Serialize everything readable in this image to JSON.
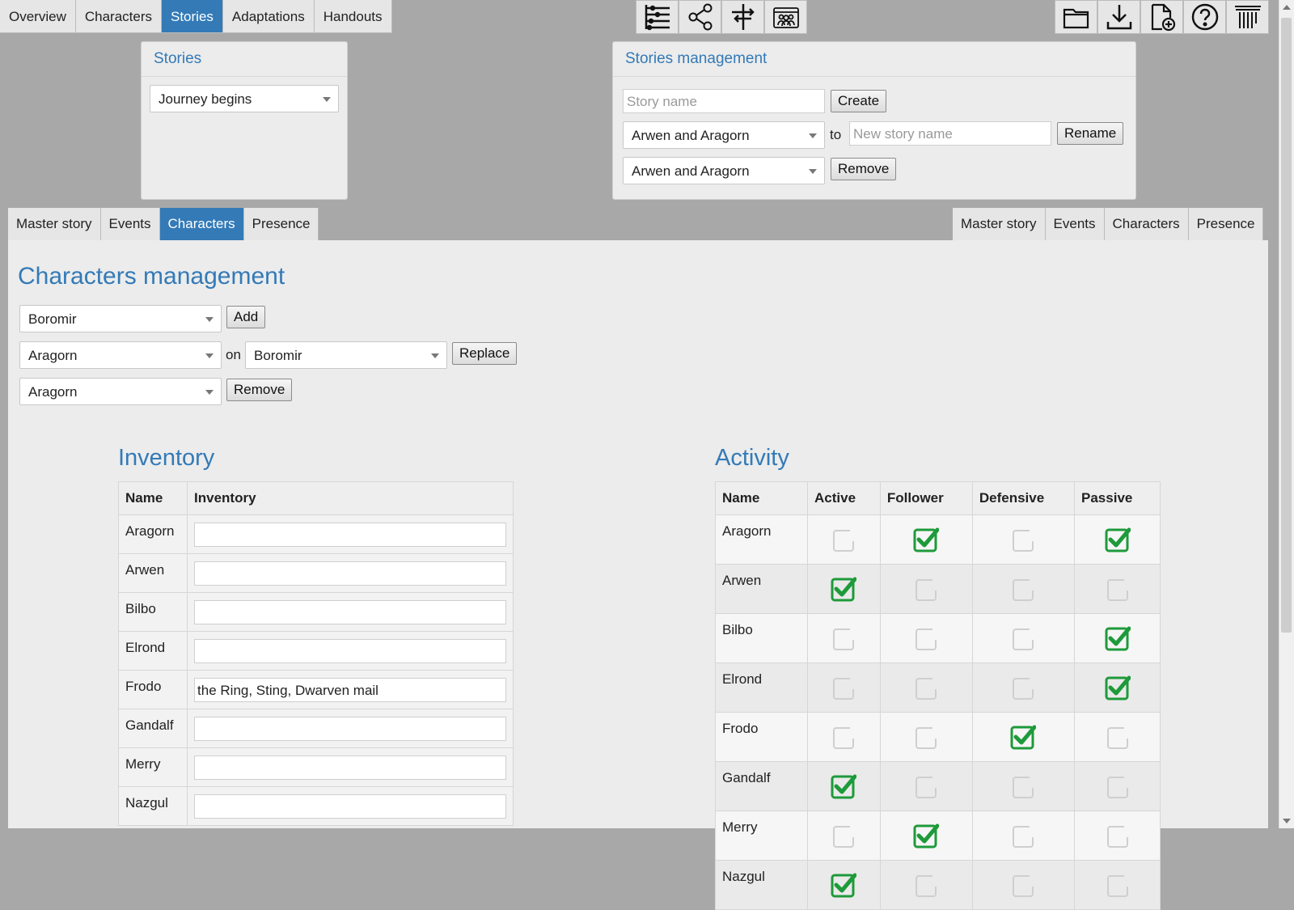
{
  "topnav": {
    "tabs": [
      "Overview",
      "Characters",
      "Stories",
      "Adaptations",
      "Handouts"
    ],
    "active": "Stories"
  },
  "toolbar": {
    "center_icons": [
      "timeline-icon",
      "share-icon",
      "signpost-icon",
      "group-icon"
    ],
    "right_icons": [
      "folder-icon",
      "download-icon",
      "new-file-icon",
      "help-icon",
      "temple-icon"
    ]
  },
  "stories_panel": {
    "title": "Stories",
    "selected_story": "Journey begins"
  },
  "stories_management": {
    "title": "Stories management",
    "story_name_placeholder": "Story name",
    "create_label": "Create",
    "rename_from": "Arwen and Aragorn",
    "to_label": "to",
    "new_name_placeholder": "New story name",
    "rename_label": "Rename",
    "remove_select": "Arwen and Aragorn",
    "remove_label": "Remove"
  },
  "subtabs_left": [
    "Master story",
    "Events",
    "Characters",
    "Presence"
  ],
  "subtabs_left_active": "Characters",
  "subtabs_right": [
    "Master story",
    "Events",
    "Characters",
    "Presence"
  ],
  "characters_management": {
    "title": "Characters management",
    "add_select": "Boromir",
    "add_label": "Add",
    "replace_from": "Aragorn",
    "on_label": "on",
    "replace_to": "Boromir",
    "replace_label": "Replace",
    "remove_select": "Aragorn",
    "remove_label": "Remove"
  },
  "inventory": {
    "title": "Inventory",
    "headers": [
      "Name",
      "Inventory"
    ],
    "rows": [
      {
        "name": "Aragorn",
        "value": ""
      },
      {
        "name": "Arwen",
        "value": ""
      },
      {
        "name": "Bilbo",
        "value": ""
      },
      {
        "name": "Elrond",
        "value": ""
      },
      {
        "name": "Frodo",
        "value": "the Ring, Sting, Dwarven mail"
      },
      {
        "name": "Gandalf",
        "value": ""
      },
      {
        "name": "Merry",
        "value": ""
      },
      {
        "name": "Nazgul",
        "value": ""
      }
    ]
  },
  "activity": {
    "title": "Activity",
    "headers": [
      "Name",
      "Active",
      "Follower",
      "Defensive",
      "Passive"
    ],
    "rows": [
      {
        "name": "Aragorn",
        "checks": [
          false,
          true,
          false,
          true
        ]
      },
      {
        "name": "Arwen",
        "checks": [
          true,
          false,
          false,
          false
        ]
      },
      {
        "name": "Bilbo",
        "checks": [
          false,
          false,
          false,
          true
        ]
      },
      {
        "name": "Elrond",
        "checks": [
          false,
          false,
          false,
          true
        ]
      },
      {
        "name": "Frodo",
        "checks": [
          false,
          false,
          true,
          false
        ]
      },
      {
        "name": "Gandalf",
        "checks": [
          true,
          false,
          false,
          false
        ]
      },
      {
        "name": "Merry",
        "checks": [
          false,
          true,
          false,
          false
        ]
      },
      {
        "name": "Nazgul",
        "checks": [
          true,
          false,
          false,
          false
        ]
      }
    ]
  },
  "colors": {
    "accent": "#337ab7",
    "check_green": "#1e9a3a",
    "background": "#a8a8a8"
  }
}
